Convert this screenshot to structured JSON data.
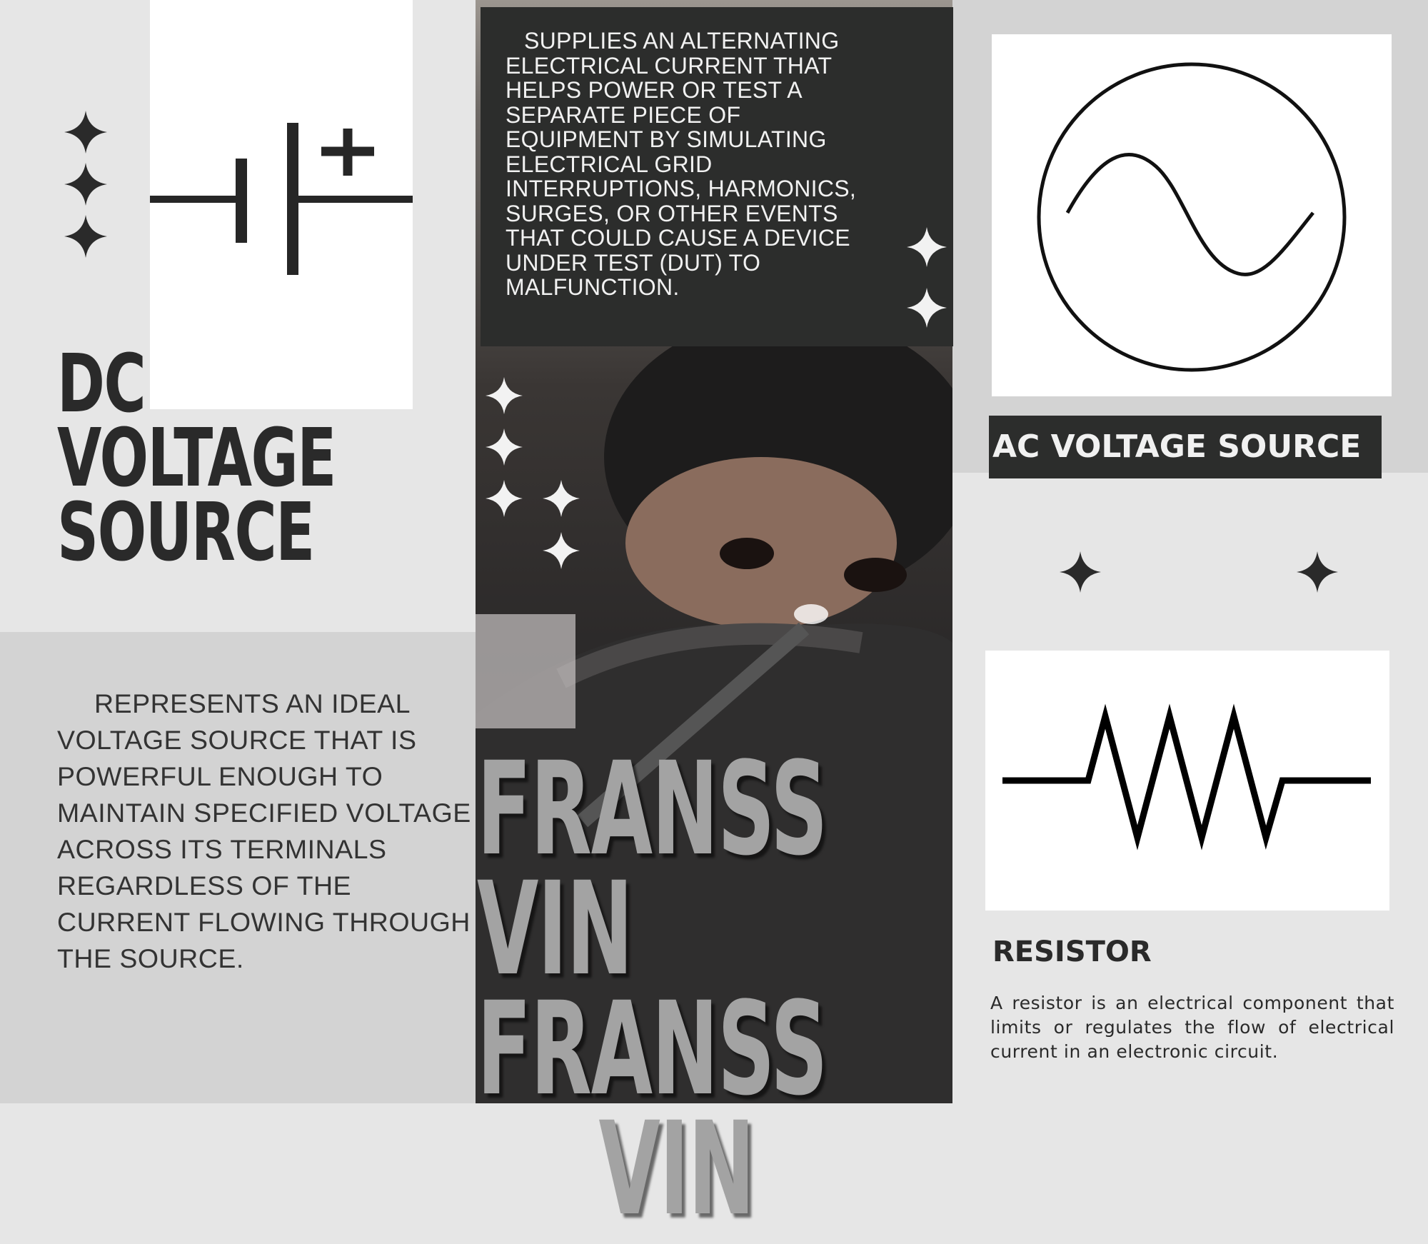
{
  "dc": {
    "title_lines": [
      "DC",
      "VOLTAGE",
      "SOURCE"
    ],
    "description": "REPRESENTS AN IDEAL VOLTAGE SOURCE THAT IS POWERFUL ENOUGH TO MAINTAIN SPECIFIED VOLTAGE ACROSS ITS TERMINALS REGARDLESS OF THE CURRENT FLOWING THROUGH THE SOURCE.",
    "symbol_icon": "dc-battery-symbol-icon",
    "plus_sign": "+"
  },
  "ac": {
    "description": "SUPPLIES AN ALTERNATING ELECTRICAL CURRENT THAT HELPS POWER OR TEST A SEPARATE PIECE OF EQUIPMENT BY SIMULATING ELECTRICAL GRID INTERRUPTIONS, HARMONICS, SURGES, OR OTHER EVENTS THAT COULD CAUSE A DEVICE UNDER TEST (DUT) TO MALFUNCTION.",
    "label": "AC VOLTAGE SOURCE",
    "symbol_icon": "ac-source-symbol-icon"
  },
  "resistor": {
    "title": "RESISTOR",
    "description": "A resistor is an electrical component that limits or regulates the flow of electrical current in an electronic circuit.",
    "symbol_icon": "resistor-symbol-icon"
  },
  "name": {
    "lines": [
      "FRANSS",
      "VIN FRANSS",
      "VIN"
    ]
  },
  "colors": {
    "dark_panel": "#2c2d2c",
    "light_bg": "#e6e6e6",
    "mid_bg": "#d3d3d3",
    "name_text": "#a3a3a3"
  }
}
